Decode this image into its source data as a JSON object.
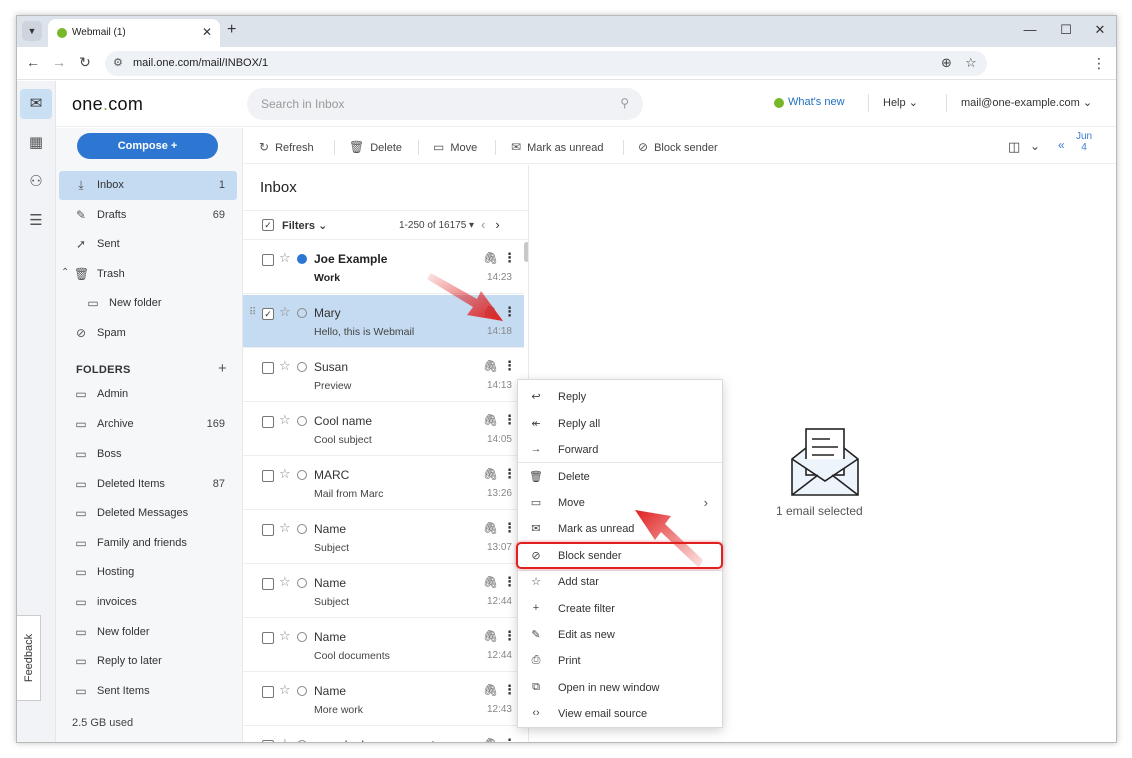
{
  "browser": {
    "tab_title": "Webmail (1)",
    "url": "mail.one.com/mail/INBOX/1"
  },
  "app": {
    "logo_prefix": "one",
    "logo_dot": ".",
    "logo_suffix": "com",
    "search_placeholder": "Search in Inbox",
    "whats_new": "What's new",
    "help": "Help",
    "account": "mail@one-example.com",
    "feedback": "Feedback"
  },
  "sidebar": {
    "compose": "Compose +",
    "nav": [
      {
        "label": "Inbox",
        "count": "1"
      },
      {
        "label": "Drafts",
        "count": "69"
      },
      {
        "label": "Sent",
        "count": ""
      },
      {
        "label": "Trash",
        "count": ""
      },
      {
        "label": "New folder",
        "count": ""
      },
      {
        "label": "Spam",
        "count": ""
      }
    ],
    "folders_title": "FOLDERS",
    "folders": [
      {
        "label": "Admin",
        "count": ""
      },
      {
        "label": "Archive",
        "count": "169"
      },
      {
        "label": "Boss",
        "count": ""
      },
      {
        "label": "Deleted Items",
        "count": "87"
      },
      {
        "label": "Deleted Messages",
        "count": ""
      },
      {
        "label": "Family and friends",
        "count": ""
      },
      {
        "label": "Hosting",
        "count": ""
      },
      {
        "label": "invoices",
        "count": ""
      },
      {
        "label": "New folder",
        "count": ""
      },
      {
        "label": "Reply to later",
        "count": ""
      },
      {
        "label": "Sent Items",
        "count": ""
      }
    ],
    "storage": "2.5 GB used"
  },
  "actions": {
    "refresh": "Refresh",
    "delete": "Delete",
    "move": "Move",
    "mark_unread": "Mark as unread",
    "block_sender": "Block sender",
    "date_month": "Jun",
    "date_day": "4"
  },
  "list": {
    "title": "Inbox",
    "filters": "Filters",
    "paging": "1-250 of 16175 ▾",
    "mails": [
      {
        "sender": "Joe Example",
        "subject": "Work",
        "time": "14:23",
        "unread": true,
        "selected": false
      },
      {
        "sender": "Mary",
        "subject": "Hello, this is Webmail",
        "time": "14:18",
        "unread": false,
        "selected": true
      },
      {
        "sender": "Susan",
        "subject": "Preview",
        "time": "14:13",
        "unread": false,
        "selected": false
      },
      {
        "sender": "Cool name",
        "subject": "Cool subject",
        "time": "14:05",
        "unread": false,
        "selected": false
      },
      {
        "sender": "MARC",
        "subject": "Mail from Marc",
        "time": "13:26",
        "unread": false,
        "selected": false
      },
      {
        "sender": "Name",
        "subject": "Subject",
        "time": "13:07",
        "unread": false,
        "selected": false
      },
      {
        "sender": "Name",
        "subject": "Subject",
        "time": "12:44",
        "unread": false,
        "selected": false
      },
      {
        "sender": "Name",
        "subject": "Cool documents",
        "time": "12:44",
        "unread": false,
        "selected": false
      },
      {
        "sender": "Name",
        "subject": "More work",
        "time": "12:43",
        "unread": false,
        "selected": false
      },
      {
        "sender": "noreply-dmarc-support",
        "subject": "",
        "time": "",
        "unread": false,
        "selected": false
      }
    ]
  },
  "preview": {
    "selected_text": "1 email selected"
  },
  "context_menu": {
    "items": [
      {
        "label": "Reply",
        "icon": "reply-icon",
        "glyph": "↩"
      },
      {
        "label": "Reply all",
        "icon": "reply-all-icon",
        "glyph": "↞"
      },
      {
        "label": "Forward",
        "icon": "forward-icon",
        "glyph": "→"
      },
      {
        "label": "Delete",
        "icon": "trash-icon",
        "glyph": "🗑"
      },
      {
        "label": "Move",
        "icon": "folder-icon",
        "glyph": "▭"
      },
      {
        "label": "Mark as unread",
        "icon": "envelope-icon",
        "glyph": "✉"
      },
      {
        "label": "Block sender",
        "icon": "block-user-icon",
        "glyph": "⊘"
      },
      {
        "label": "Add star",
        "icon": "star-icon",
        "glyph": "☆"
      },
      {
        "label": "Create filter",
        "icon": "plus-icon",
        "glyph": "+"
      },
      {
        "label": "Edit as new",
        "icon": "pencil-icon",
        "glyph": "✎"
      },
      {
        "label": "Print",
        "icon": "printer-icon",
        "glyph": "⎙"
      },
      {
        "label": "Open in new window",
        "icon": "external-window-icon",
        "glyph": "⧉"
      },
      {
        "label": "View email source",
        "icon": "code-icon",
        "glyph": "‹›"
      }
    ]
  },
  "colors": {
    "accent": "#2d77d2",
    "brand_green": "#76b82a",
    "selection": "#c4dbf1",
    "annotation_red": "#e02020"
  }
}
